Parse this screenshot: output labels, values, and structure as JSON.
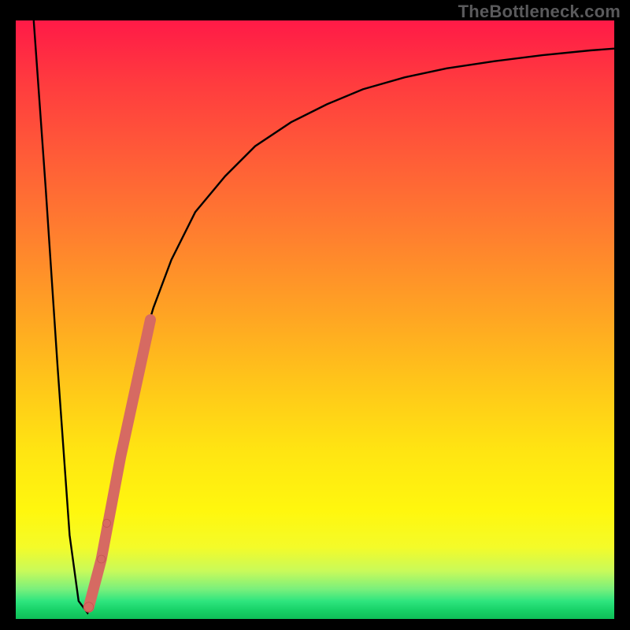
{
  "watermark": "TheBottleneck.com",
  "colors": {
    "curve": "#000000",
    "highlight": "#d66a62"
  },
  "chart_data": {
    "type": "line",
    "title": "",
    "xlabel": "",
    "ylabel": "",
    "xlim": [
      0,
      100
    ],
    "ylim": [
      0,
      100
    ],
    "series": [
      {
        "name": "bottleneck-curve",
        "x": [
          3,
          5,
          7,
          9,
          10.5,
          12,
          13,
          14,
          16,
          18,
          20,
          23,
          26,
          30,
          35,
          40,
          46,
          52,
          58,
          65,
          72,
          80,
          88,
          96,
          100
        ],
        "y": [
          100,
          72,
          42,
          14,
          3,
          1,
          3,
          8,
          20,
          32,
          42,
          52,
          60,
          68,
          74,
          79,
          83,
          86,
          88.5,
          90.5,
          92,
          93.2,
          94.2,
          95,
          95.3
        ]
      }
    ],
    "highlight_segment": {
      "name": "recommended-range",
      "x": [
        12.2,
        14.3,
        17.5,
        22.5
      ],
      "y": [
        2,
        10,
        27,
        50
      ]
    },
    "highlight_points": [
      {
        "x": 12.2,
        "y": 2,
        "r": 6
      },
      {
        "x": 14.3,
        "y": 10,
        "r": 5
      },
      {
        "x": 15.2,
        "y": 16,
        "r": 5
      }
    ]
  }
}
